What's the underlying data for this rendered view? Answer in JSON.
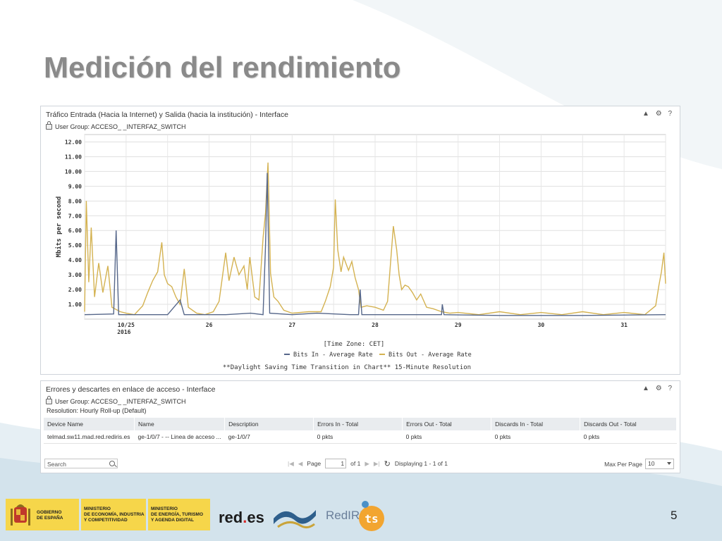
{
  "slide": {
    "title": "Medición del rendimiento",
    "page_number": "5"
  },
  "panel_traffic": {
    "title": "Tráfico Entrada (Hacia la Internet) y Salida (hacia la institución) - Interface",
    "user_group": "User Group: ACCESO_        _INTERFAZ_SWITCH",
    "tools": [
      "▲",
      "⚙",
      "?"
    ]
  },
  "chart_data": {
    "type": "line",
    "ylabel": "Mbits per second",
    "xlabel": "[Time Zone: CET]",
    "y_ticks": [
      "1.00",
      "2.00",
      "3.00",
      "4.00",
      "5.00",
      "6.00",
      "7.00",
      "8.00",
      "9.00",
      "10.00",
      "11.00",
      "12.00"
    ],
    "ylim": [
      0,
      12.5
    ],
    "x_ticks": [
      {
        "day": 0.5,
        "label": "10/25",
        "sub": "2016"
      },
      {
        "day": 1.5,
        "label": "26"
      },
      {
        "day": 2.5,
        "label": "27"
      },
      {
        "day": 3.5,
        "label": "28"
      },
      {
        "day": 4.5,
        "label": "29"
      },
      {
        "day": 5.5,
        "label": "30"
      },
      {
        "day": 6.5,
        "label": "31"
      }
    ],
    "xlim": [
      0,
      7
    ],
    "series": [
      {
        "name": "Bits In - Average Rate",
        "color": "#56678a",
        "points": [
          [
            0,
            0.3
          ],
          [
            0.35,
            0.35
          ],
          [
            0.38,
            6.0
          ],
          [
            0.41,
            0.3
          ],
          [
            1.0,
            0.3
          ],
          [
            1.15,
            1.3
          ],
          [
            1.2,
            0.3
          ],
          [
            1.7,
            0.3
          ],
          [
            2.0,
            0.4
          ],
          [
            2.15,
            0.3
          ],
          [
            2.18,
            5.0
          ],
          [
            2.2,
            9.9
          ],
          [
            2.23,
            0.4
          ],
          [
            2.5,
            0.3
          ],
          [
            2.8,
            0.4
          ],
          [
            3.2,
            0.3
          ],
          [
            3.3,
            0.3
          ],
          [
            3.32,
            2.0
          ],
          [
            3.34,
            0.3
          ],
          [
            4.0,
            0.3
          ],
          [
            4.3,
            0.3
          ],
          [
            4.31,
            1.0
          ],
          [
            4.33,
            0.3
          ],
          [
            5.0,
            0.25
          ],
          [
            6.0,
            0.25
          ],
          [
            7.0,
            0.3
          ]
        ]
      },
      {
        "name": "Bits Out - Average Rate",
        "color": "#d4b251",
        "points": [
          [
            0,
            0.5
          ],
          [
            0.02,
            8.0
          ],
          [
            0.05,
            2.5
          ],
          [
            0.08,
            6.2
          ],
          [
            0.12,
            1.5
          ],
          [
            0.17,
            3.8
          ],
          [
            0.22,
            1.8
          ],
          [
            0.28,
            3.6
          ],
          [
            0.33,
            0.8
          ],
          [
            0.43,
            0.5
          ],
          [
            0.5,
            0.4
          ],
          [
            0.6,
            0.3
          ],
          [
            0.7,
            0.9
          ],
          [
            0.76,
            1.8
          ],
          [
            0.82,
            2.6
          ],
          [
            0.88,
            3.2
          ],
          [
            0.91,
            4.4
          ],
          [
            0.93,
            5.2
          ],
          [
            0.96,
            3.0
          ],
          [
            1.0,
            2.4
          ],
          [
            1.05,
            2.2
          ],
          [
            1.1,
            1.5
          ],
          [
            1.15,
            1.0
          ],
          [
            1.2,
            3.4
          ],
          [
            1.25,
            0.8
          ],
          [
            1.35,
            0.4
          ],
          [
            1.45,
            0.3
          ],
          [
            1.55,
            0.5
          ],
          [
            1.62,
            1.2
          ],
          [
            1.7,
            4.5
          ],
          [
            1.74,
            2.6
          ],
          [
            1.8,
            4.2
          ],
          [
            1.86,
            3.0
          ],
          [
            1.92,
            3.6
          ],
          [
            1.96,
            2.0
          ],
          [
            1.99,
            4.2
          ],
          [
            2.05,
            1.5
          ],
          [
            2.1,
            1.3
          ],
          [
            2.15,
            5.5
          ],
          [
            2.18,
            7.2
          ],
          [
            2.21,
            10.6
          ],
          [
            2.24,
            3.1
          ],
          [
            2.28,
            1.5
          ],
          [
            2.33,
            1.2
          ],
          [
            2.4,
            0.6
          ],
          [
            2.5,
            0.4
          ],
          [
            2.7,
            0.5
          ],
          [
            2.85,
            0.5
          ],
          [
            2.9,
            1.2
          ],
          [
            2.96,
            2.2
          ],
          [
            3.0,
            3.5
          ],
          [
            3.02,
            8.1
          ],
          [
            3.05,
            4.7
          ],
          [
            3.09,
            3.2
          ],
          [
            3.12,
            4.2
          ],
          [
            3.18,
            3.3
          ],
          [
            3.22,
            3.9
          ],
          [
            3.26,
            2.8
          ],
          [
            3.3,
            2.0
          ],
          [
            3.33,
            0.8
          ],
          [
            3.4,
            0.9
          ],
          [
            3.5,
            0.8
          ],
          [
            3.6,
            0.6
          ],
          [
            3.65,
            1.2
          ],
          [
            3.72,
            6.3
          ],
          [
            3.76,
            4.7
          ],
          [
            3.79,
            3.0
          ],
          [
            3.82,
            2.0
          ],
          [
            3.86,
            2.3
          ],
          [
            3.9,
            2.2
          ],
          [
            3.95,
            1.8
          ],
          [
            4.0,
            1.3
          ],
          [
            4.05,
            1.7
          ],
          [
            4.12,
            0.8
          ],
          [
            4.2,
            0.7
          ],
          [
            4.3,
            0.5
          ],
          [
            4.4,
            0.4
          ],
          [
            4.5,
            0.45
          ],
          [
            4.75,
            0.3
          ],
          [
            5.0,
            0.5
          ],
          [
            5.25,
            0.3
          ],
          [
            5.5,
            0.45
          ],
          [
            5.75,
            0.3
          ],
          [
            6.0,
            0.5
          ],
          [
            6.25,
            0.3
          ],
          [
            6.5,
            0.45
          ],
          [
            6.75,
            0.3
          ],
          [
            6.88,
            0.9
          ],
          [
            6.92,
            2.3
          ],
          [
            6.95,
            3.2
          ],
          [
            6.98,
            4.5
          ],
          [
            7.0,
            2.4
          ]
        ]
      }
    ],
    "footnote": "**Daylight Saving Time Transition in Chart** 15-Minute Resolution"
  },
  "panel_errors": {
    "title": "Errores y descartes en enlace de acceso - Interface",
    "user_group": "User Group: ACCESO_        _INTERFAZ_SWITCH",
    "resolution": "Resolution: Hourly Roll-up (Default)",
    "tools": [
      "▲",
      "⚙",
      "?"
    ],
    "columns": [
      "Device Name",
      "Name",
      "Description",
      "Errors In - Total",
      "Errors Out - Total",
      "Discards In - Total",
      "Discards Out - Total"
    ],
    "rows": [
      [
        "telmad.sw11.mad.red.rediris.es",
        "ge-1/0/7 - -- Linea de acceso ...",
        "ge-1/0/7",
        "0 pkts",
        "0 pkts",
        "0 pkts",
        "0 pkts"
      ]
    ],
    "search_placeholder": "Search",
    "pager": {
      "page_label": "Page",
      "page_value": "1",
      "of_label": "of 1",
      "displaying": "Displaying 1 - 1 of 1",
      "max_label": "Max Per Page",
      "max_value": "10"
    }
  },
  "footer": {
    "gobierno": "GOBIERNO\nDE ESPAÑA",
    "ministerio1": "MINISTERIO\nDE ECONOMÍA, INDUSTRIA\nY COMPETITIVIDAD",
    "ministerio2": "MINISTERIO\nDE ENERGÍA, TURISMO\nY AGENDA DIGITAL",
    "redes_pre": "red",
    "redes_dot": ".",
    "redes_post": "es",
    "rediris": "RedIRIS"
  }
}
